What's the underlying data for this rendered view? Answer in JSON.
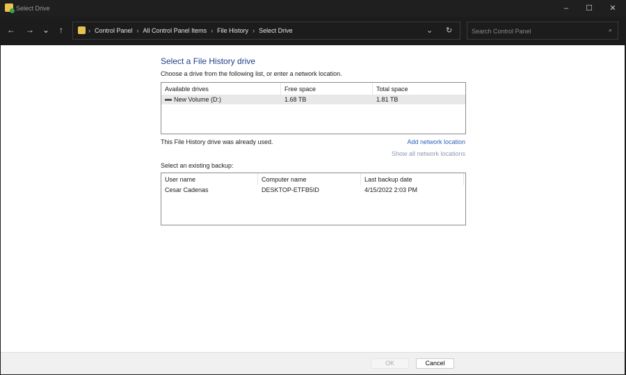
{
  "window": {
    "title": "Select Drive"
  },
  "nav": {
    "back": "←",
    "forward": "→",
    "recent": "⌄",
    "up": "↑",
    "breadcrumbs": [
      "Control Panel",
      "All Control Panel Items",
      "File History",
      "Select Drive"
    ],
    "refresh": "↻",
    "dropdown": "⌄"
  },
  "search": {
    "placeholder": "Search Control Panel"
  },
  "main": {
    "title": "Select a File History drive",
    "instruction": "Choose a drive from the following list, or enter a network location.",
    "drives": {
      "headers": [
        "Available drives",
        "Free space",
        "Total space"
      ],
      "rows": [
        {
          "name": "New Volume (D:)",
          "free": "1.68 TB",
          "total": "1.81 TB"
        }
      ]
    },
    "status": "This File History drive was already used.",
    "add_network": "Add network location",
    "show_network": "Show all network locations",
    "backup_label": "Select an existing backup:",
    "backups": {
      "headers": [
        "User name",
        "Computer name",
        "Last backup date"
      ],
      "rows": [
        {
          "user": "Cesar Cadenas",
          "computer": "DESKTOP-ETFB5ID",
          "date": "4/15/2022 2:03 PM"
        }
      ]
    }
  },
  "footer": {
    "ok": "OK",
    "cancel": "Cancel"
  }
}
